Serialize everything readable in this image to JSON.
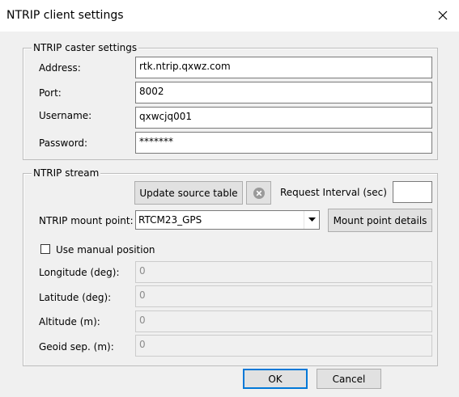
{
  "window": {
    "title": "NTRIP client settings"
  },
  "caster": {
    "group_title": "NTRIP caster settings",
    "address_label": "Address:",
    "address_value": "rtk.ntrip.qxwz.com",
    "port_label": "Port:",
    "port_value": "8002",
    "username_label": "Username:",
    "username_value": "qxwcjq001",
    "password_label": "Password:",
    "password_value": "*******"
  },
  "stream": {
    "group_title": "NTRIP stream",
    "update_button": "Update source table",
    "request_interval_label": "Request Interval (sec)",
    "request_interval_value": "",
    "mount_point_label": "NTRIP mount point:",
    "mount_point_value": "RTCM23_GPS",
    "mount_details_button": "Mount point details",
    "manual_position_label": "Use manual position",
    "manual_position_checked": false,
    "longitude_label": "Longitude (deg):",
    "longitude_value": "0",
    "latitude_label": "Latitude (deg):",
    "latitude_value": "0",
    "altitude_label": "Altitude (m):",
    "altitude_value": "0",
    "geoid_label": "Geoid sep. (m):",
    "geoid_value": "0"
  },
  "footer": {
    "ok": "OK",
    "cancel": "Cancel"
  }
}
